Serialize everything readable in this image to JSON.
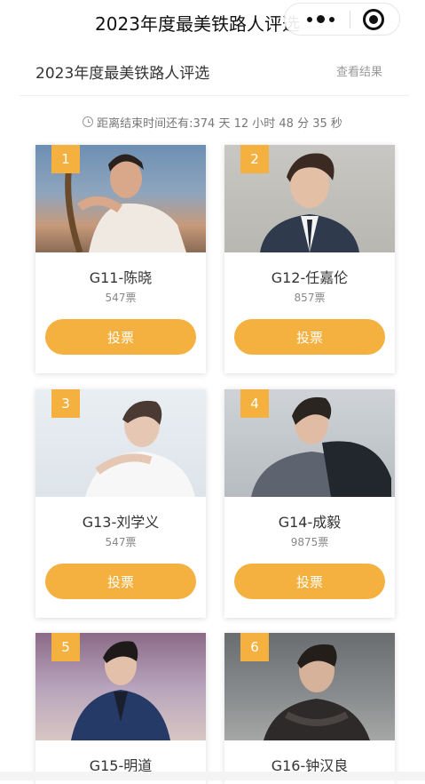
{
  "nav": {
    "title": "2023年度最美铁路人评选",
    "more_icon": "more-dots-icon",
    "close_icon": "target-close-icon"
  },
  "header": {
    "title": "2023年度最美铁路人评选",
    "view_results": "查看结果"
  },
  "countdown": {
    "icon": "clock-icon",
    "text": "距离结束时间还有:374 天 12 小时 48 分 35 秒"
  },
  "colors": {
    "accent": "#f4b13f",
    "text": "#333333",
    "muted": "#888888"
  },
  "candidates": [
    {
      "rank": "1",
      "name": "G11-陈晓",
      "votes": "547票",
      "vote_label": "投票"
    },
    {
      "rank": "2",
      "name": "G12-任嘉伦",
      "votes": "857票",
      "vote_label": "投票"
    },
    {
      "rank": "3",
      "name": "G13-刘学义",
      "votes": "547票",
      "vote_label": "投票"
    },
    {
      "rank": "4",
      "name": "G14-成毅",
      "votes": "9875票",
      "vote_label": "投票"
    },
    {
      "rank": "5",
      "name": "G15-明道",
      "votes": "",
      "vote_label": ""
    },
    {
      "rank": "6",
      "name": "G16-钟汉良",
      "votes": "",
      "vote_label": ""
    }
  ]
}
